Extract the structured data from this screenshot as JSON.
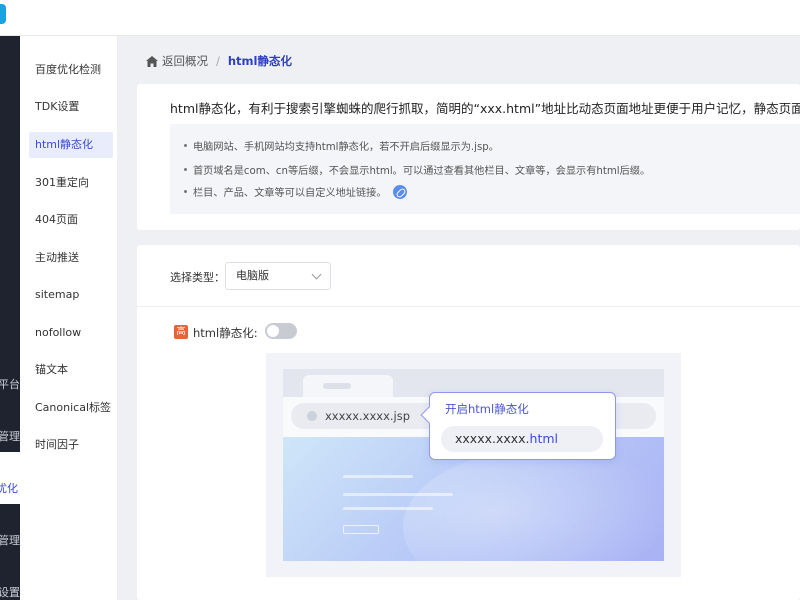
{
  "rail": {
    "items": [
      "平台",
      "管理",
      "优化",
      "管理",
      "设置"
    ]
  },
  "submenu": {
    "items": [
      {
        "label": "百度优化检测",
        "active": false
      },
      {
        "label": "TDK设置",
        "active": false
      },
      {
        "label": "html静态化",
        "active": true
      },
      {
        "label": "301重定向",
        "active": false
      },
      {
        "label": "404页面",
        "active": false
      },
      {
        "label": "主动推送",
        "active": false
      },
      {
        "label": "sitemap",
        "active": false
      },
      {
        "label": "nofollow",
        "active": false
      },
      {
        "label": "锚文本",
        "active": false
      },
      {
        "label": "Canonical标签",
        "active": false
      },
      {
        "label": "时间因子",
        "active": false
      }
    ]
  },
  "breadcrumb": {
    "back_label": "返回概况",
    "separator": "/",
    "current": "html静态化"
  },
  "intro": {
    "text": "html静态化，有利于搜索引擎蜘蛛的爬行抓取，简明的“xxx.html”地址比动态页面地址更便于用户记忆，静态页面的"
  },
  "notice": {
    "items": [
      "电脑网站、手机网站均支持html静态化，若不开启后缀显示为.jsp。",
      "首页域名是com、cn等后缀，不会显示html。可以通过查看其他栏目、文章等，会显示有html后缀。",
      "栏目、产品、文章等可以自定义地址链接。"
    ]
  },
  "settings": {
    "type_label": "选择类型：",
    "type_value": "电脑版",
    "badge": "高",
    "toggle_label": "html静态化:",
    "toggle_on": false
  },
  "illustration": {
    "url_text": "xxxxx.xxxx.jsp",
    "popover_title": "开启html静态化",
    "popover_url_base": "xxxxx.xxxx.",
    "popover_url_ext": "html"
  },
  "colors": {
    "accent": "#3a4bd8",
    "sidebar_dark": "#1f2330",
    "badge": "#e8623d"
  }
}
